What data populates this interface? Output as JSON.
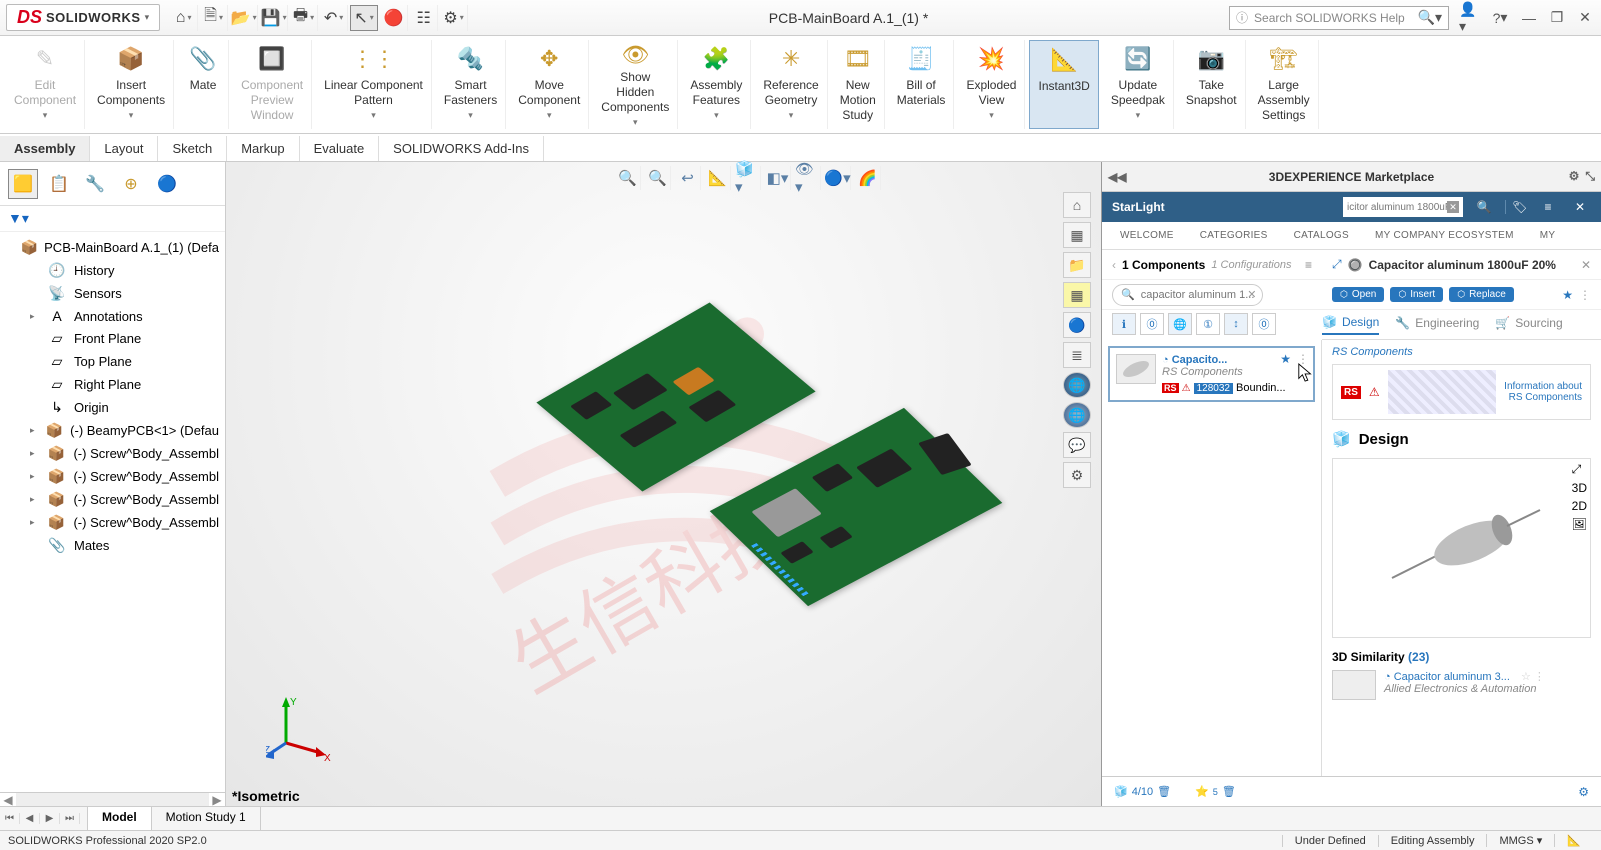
{
  "app": {
    "brand": "SOLIDWORKS",
    "ds_prefix": "DS",
    "title": "PCB-MainBoard A.1_(1) *",
    "search_placeholder": "Search SOLIDWORKS Help",
    "help_icon": "?",
    "window_buttons": {
      "min": "—",
      "max": "❐",
      "close": "✕"
    }
  },
  "quick_access": [
    {
      "name": "home-icon",
      "glyph": "⌂",
      "drop": true
    },
    {
      "name": "new-icon",
      "glyph": "🗎",
      "drop": true
    },
    {
      "name": "open-icon",
      "glyph": "📂",
      "drop": true
    },
    {
      "name": "save-icon",
      "glyph": "💾",
      "drop": true
    },
    {
      "name": "print-icon",
      "glyph": "🖶",
      "drop": true
    },
    {
      "name": "undo-icon",
      "glyph": "↶",
      "drop": true
    },
    {
      "name": "select-icon",
      "glyph": "↖",
      "drop": true,
      "selected": true
    },
    {
      "name": "rebuild-icon",
      "glyph": "🔴",
      "drop": false
    },
    {
      "name": "options-list-icon",
      "glyph": "☷",
      "drop": false
    },
    {
      "name": "settings-icon",
      "glyph": "⚙",
      "drop": true
    }
  ],
  "ribbon": [
    {
      "name": "edit-component",
      "label": "Edit\nComponent",
      "glyph": "✎",
      "disabled": true,
      "drop": true
    },
    {
      "name": "insert-components",
      "label": "Insert\nComponents",
      "glyph": "📦",
      "drop": true
    },
    {
      "name": "mate",
      "label": "Mate",
      "glyph": "📎"
    },
    {
      "name": "component-preview",
      "label": "Component\nPreview\nWindow",
      "glyph": "🔲",
      "disabled": true
    },
    {
      "name": "linear-pattern",
      "label": "Linear Component\nPattern",
      "glyph": "⋮⋮",
      "drop": true
    },
    {
      "name": "smart-fasteners",
      "label": "Smart\nFasteners",
      "glyph": "🔩",
      "drop": true
    },
    {
      "name": "move-component",
      "label": "Move\nComponent",
      "glyph": "✥",
      "drop": true
    },
    {
      "name": "show-hidden",
      "label": "Show\nHidden\nComponents",
      "glyph": "👁",
      "drop": true
    },
    {
      "name": "assembly-features",
      "label": "Assembly\nFeatures",
      "glyph": "🧩",
      "drop": true
    },
    {
      "name": "reference-geometry",
      "label": "Reference\nGeometry",
      "glyph": "✳",
      "drop": true
    },
    {
      "name": "new-motion-study",
      "label": "New\nMotion\nStudy",
      "glyph": "🎞"
    },
    {
      "name": "bill-of-materials",
      "label": "Bill of\nMaterials",
      "glyph": "🧾"
    },
    {
      "name": "exploded-view",
      "label": "Exploded\nView",
      "glyph": "💥",
      "drop": true
    },
    {
      "name": "instant3d",
      "label": "Instant3D",
      "glyph": "📐",
      "active": true
    },
    {
      "name": "update-speedpak",
      "label": "Update\nSpeedpak",
      "glyph": "🔄",
      "drop": true
    },
    {
      "name": "take-snapshot",
      "label": "Take\nSnapshot",
      "glyph": "📷"
    },
    {
      "name": "large-assembly",
      "label": "Large\nAssembly\nSettings",
      "glyph": "🏗"
    }
  ],
  "command_tabs": [
    "Assembly",
    "Layout",
    "Sketch",
    "Markup",
    "Evaluate",
    "SOLIDWORKS Add-Ins"
  ],
  "command_tab_active": 0,
  "feature_tree": {
    "root": "PCB-MainBoard A.1_(1)  (Defa",
    "items": [
      {
        "name": "history",
        "label": "History",
        "glyph": "🕘"
      },
      {
        "name": "sensors",
        "label": "Sensors",
        "glyph": "📡"
      },
      {
        "name": "annotations",
        "label": "Annotations",
        "glyph": "A",
        "expandable": true
      },
      {
        "name": "front-plane",
        "label": "Front Plane",
        "glyph": "▱"
      },
      {
        "name": "top-plane",
        "label": "Top Plane",
        "glyph": "▱"
      },
      {
        "name": "right-plane",
        "label": "Right Plane",
        "glyph": "▱"
      },
      {
        "name": "origin",
        "label": "Origin",
        "glyph": "↳"
      },
      {
        "name": "beamy-pcb",
        "label": "(-) BeamyPCB<1> (Defau",
        "glyph": "📦",
        "expandable": true,
        "comp": true
      },
      {
        "name": "screw1",
        "label": "(-) Screw^Body_Assembl",
        "glyph": "📦",
        "expandable": true,
        "comp": true
      },
      {
        "name": "screw2",
        "label": "(-) Screw^Body_Assembl",
        "glyph": "📦",
        "expandable": true,
        "comp": true
      },
      {
        "name": "screw3",
        "label": "(-) Screw^Body_Assembl",
        "glyph": "📦",
        "expandable": true,
        "comp": true
      },
      {
        "name": "screw4",
        "label": "(-) Screw^Body_Assembl",
        "glyph": "📦",
        "expandable": true,
        "comp": true
      },
      {
        "name": "mates",
        "label": "Mates",
        "glyph": "📎"
      }
    ]
  },
  "view": {
    "label": "*Isometric"
  },
  "bottom_tabs": {
    "tabs": [
      "Model",
      "Motion Study 1"
    ],
    "active": 0
  },
  "status": {
    "product": "SOLIDWORKS Professional 2020 SP2.0",
    "under_defined": "Under Defined",
    "editing": "Editing Assembly",
    "units": "MMGS",
    "arrow": "▾"
  },
  "marketplace": {
    "title": "3DEXPERIENCE Marketplace",
    "starlight": "StarLight",
    "search_value": "icitor aluminum 1800uF",
    "nav": [
      "WELCOME",
      "CATEGORIES",
      "CATALOGS",
      "MY COMPANY ECOSYSTEM",
      "MY"
    ],
    "result_header": {
      "count": "1 Components",
      "configs": "1 Configurations"
    },
    "detail_title_prefix": "Capacitor aluminum 1800uF 20%",
    "actions": {
      "open": "Open",
      "insert": "Insert",
      "replace": "Replace"
    },
    "detail_tabs": [
      "Design",
      "Engineering",
      "Sourcing"
    ],
    "detail_tab_active": 0,
    "search_inlist": "capacitor aluminum 1...",
    "card": {
      "name": "Capacito...",
      "supplier": "RS Components",
      "rs": "RS",
      "pn": "128032",
      "suffix": "Boundin..."
    },
    "supplier_header": "RS Components",
    "supplier_rs": "RS",
    "supplier_info_line1": "Information about",
    "supplier_info_line2": "RS Components",
    "design_section": "Design",
    "side_btns": [
      "⤢",
      "3D",
      "2D",
      "🖼"
    ],
    "side_active": 2,
    "similarity_title": "3D Similarity",
    "similarity_count": "(23)",
    "similar": {
      "name": "Capacitor aluminum 3...",
      "supplier": "Allied Electronics & Automation"
    },
    "footer": {
      "score": "4/10",
      "rating": "5"
    }
  }
}
